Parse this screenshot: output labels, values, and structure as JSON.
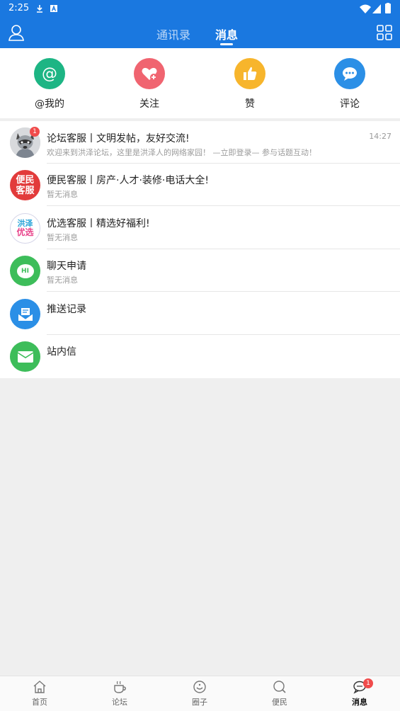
{
  "status_bar": {
    "time": "2:25"
  },
  "header": {
    "tabs": [
      {
        "label": "通讯录"
      },
      {
        "label": "消息"
      }
    ]
  },
  "quick_actions": [
    {
      "label": "@我的",
      "icon": "at-icon",
      "color": "#1db584"
    },
    {
      "label": "关注",
      "icon": "heart-plus-icon",
      "color": "#f06470"
    },
    {
      "label": "赞",
      "icon": "thumbs-up-icon",
      "color": "#f7b52c"
    },
    {
      "label": "评论",
      "icon": "comment-icon",
      "color": "#2b8fe6"
    }
  ],
  "conversations": [
    {
      "title": "论坛客服丨文明发帖，友好交流!",
      "subtitle": "欢迎来到洪泽论坛，这里是洪泽人的网络家园！ —立即登录— 参与话题互动！",
      "time": "14:27",
      "badge": "1",
      "avatar": "raccoon-avatar"
    },
    {
      "title": "便民客服丨房产·人才·装修·电话大全!",
      "subtitle": "暂无消息",
      "avatar": "bianmin-avatar",
      "avatar_text_1": "便民",
      "avatar_text_2": "客服"
    },
    {
      "title": "优选客服丨精选好福利!",
      "subtitle": "暂无消息",
      "avatar": "youxuan-avatar",
      "avatar_text_1": "洪泽",
      "avatar_text_2": "优选"
    },
    {
      "title": "聊天申请",
      "subtitle": "暂无消息",
      "avatar": "chat-hi-icon",
      "avatar_text_1": "HI"
    },
    {
      "title": "推送记录",
      "avatar": "push-inbox-icon"
    },
    {
      "title": "站内信",
      "avatar": "mail-icon"
    }
  ],
  "bottom_nav": [
    {
      "label": "首页",
      "icon": "home-icon"
    },
    {
      "label": "论坛",
      "icon": "coffee-cup-icon"
    },
    {
      "label": "圈子",
      "icon": "circle-smile-icon"
    },
    {
      "label": "便民",
      "icon": "search-icon"
    },
    {
      "label": "消息",
      "icon": "chat-bubble-icon",
      "badge": "1",
      "active": true
    }
  ],
  "colors": {
    "primary": "#1a78e0",
    "badge": "#f04b4b"
  }
}
